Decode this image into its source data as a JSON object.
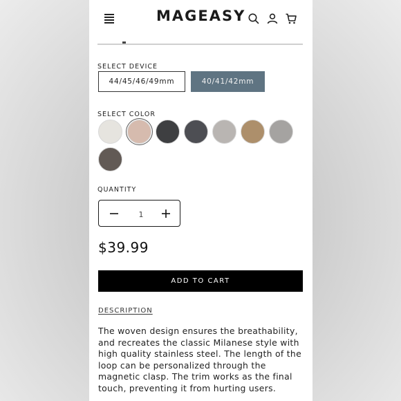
{
  "header": {
    "logo": "MAGEASY",
    "icons": [
      "menu-icon",
      "search-icon",
      "account-icon",
      "cart-icon"
    ]
  },
  "device": {
    "label": "SELECT DEVICE",
    "options": [
      "44/45/46/49mm",
      "40/41/42mm"
    ],
    "selected": "40/41/42mm"
  },
  "color": {
    "label": "SELECT COLOR",
    "swatches": [
      "#e6e4df",
      "#d6bbae",
      "#3e3f41",
      "#4d4e53",
      "#b9b5b2",
      "#ad8f6b",
      "#a5a3a1",
      "#625a55"
    ],
    "selected_index": 1
  },
  "quantity": {
    "label": "QUANTITY",
    "value": "1"
  },
  "price": "$39.99",
  "add_to_cart": "ADD TO CART",
  "description": {
    "link": "DESCRIPTION",
    "text": "The woven design ensures the breathability, and recreates the classic Milanese style with high quality stainless steel. The length of the loop can be personalized through the magnetic clasp. The trim works as the final touch, preventing it from hurting users."
  }
}
